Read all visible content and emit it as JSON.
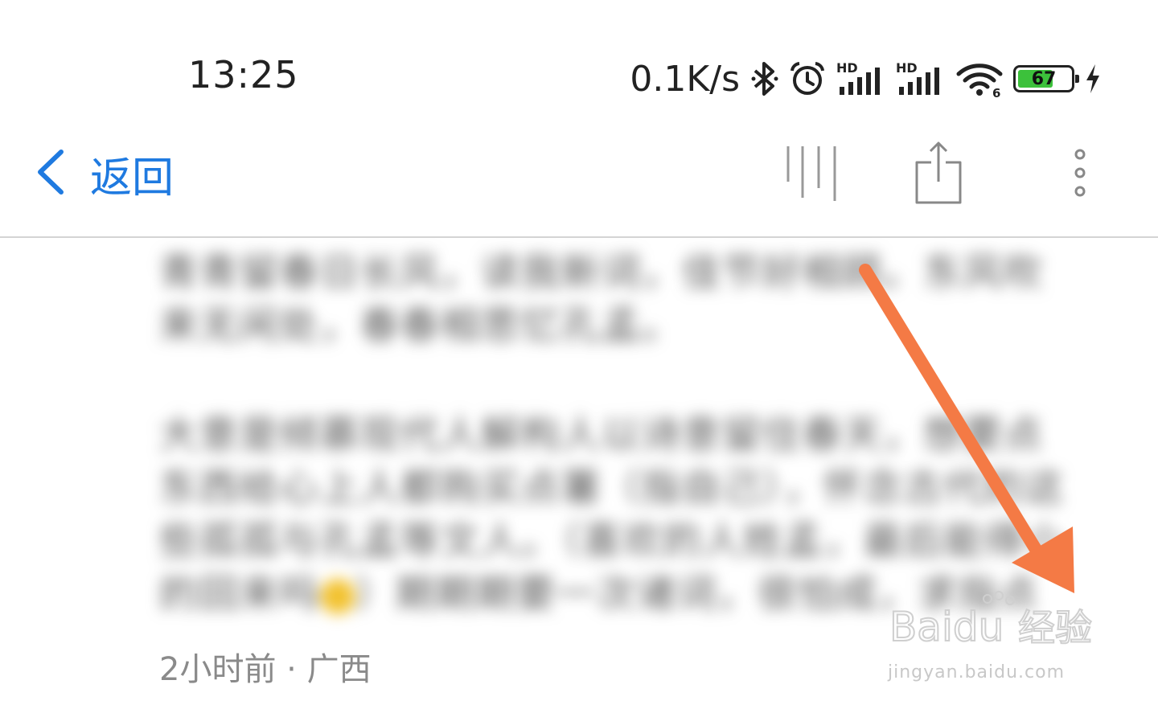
{
  "status_bar": {
    "time": "13:25",
    "net_speed": "0.1K/s",
    "icons": [
      "bluetooth-icon",
      "alarm-icon",
      "signal-hd-icon",
      "signal-hd-icon",
      "wifi-icon",
      "battery-icon",
      "charging-icon"
    ],
    "signal_label": "HD",
    "wifi_label": "6",
    "battery_level": "67",
    "battery_percent": 67
  },
  "nav": {
    "back_label": "返回",
    "actions": [
      "font-size-icon",
      "share-icon",
      "more-icon"
    ]
  },
  "content": {
    "paragraph_1": "青青留春日长风，读我新词，佳节好相顾。东风吹来无闲处，春春相思忆孔孟。",
    "paragraph_2_before_emoji": "大意是倾慕现代人解构人以诗意留住春天，想要点东西给心上人都购买点薯（指自己），怀念古代的这些孤孤与孔孟等文人。（喜欢的人姓孟，最后能得小的回来吗",
    "paragraph_2_after_emoji": "）期期期要一次诸词，很怕成，求指点",
    "meta": "2小时前 · 广西"
  },
  "watermark": {
    "brand": "Baidu",
    "cn": "经验",
    "url": "jingyan.baidu.com"
  },
  "colors": {
    "accent": "#1f7ae0",
    "arrow": "#f47a45",
    "battery": "#3cc13b"
  }
}
